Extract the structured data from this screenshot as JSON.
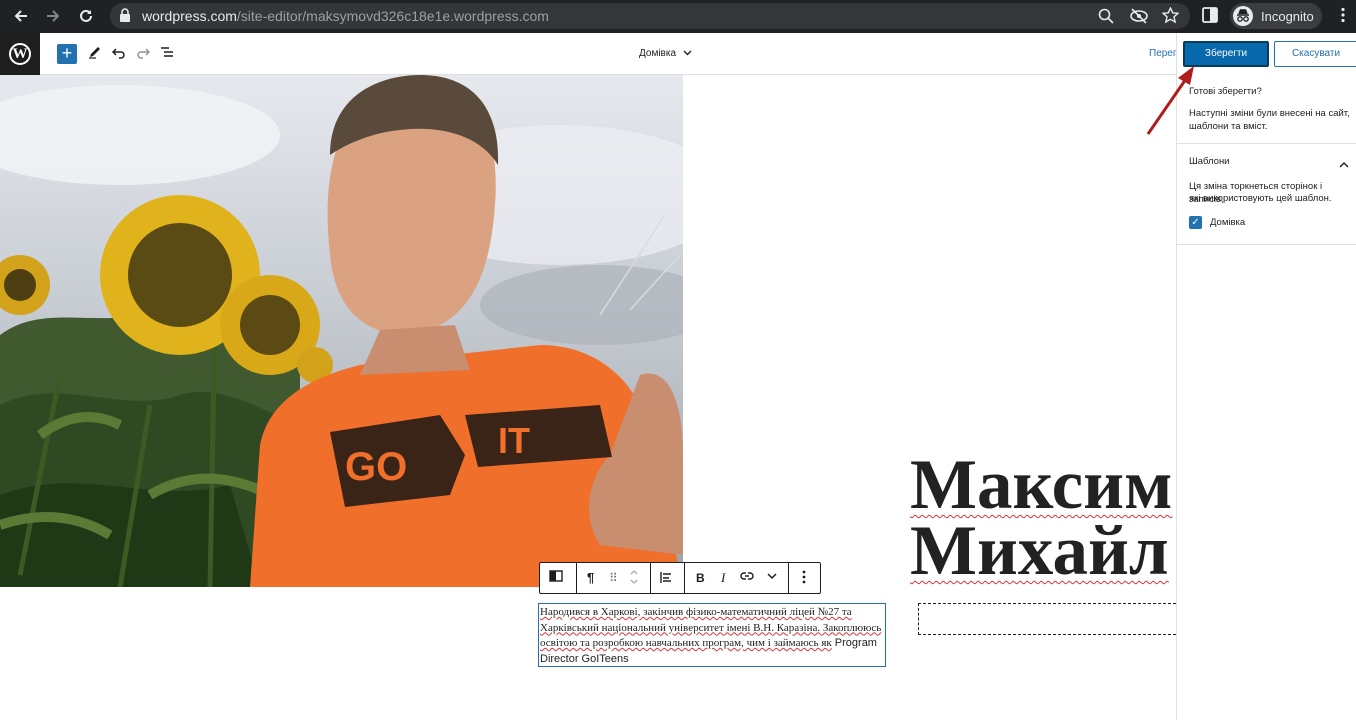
{
  "browser": {
    "url_domain": "wordpress.com",
    "url_path": "/site-editor/maksymovd326c18e1e.wordpress.com",
    "profile_label": "Incognito"
  },
  "editor": {
    "document_title": "Домівка",
    "preview_label": "Перегл"
  },
  "save_panel": {
    "save_label": "Зберегти",
    "cancel_label": "Скасувати",
    "question": "Готові зберегти?",
    "changes_line1": "Наступні зміни були внесені на сайт,",
    "changes_line2": "шаблони та вміст.",
    "templates_title": "Шаблони",
    "templates_desc_line1": "Ця зміна торкнеться сторінок і записів,",
    "templates_desc_line2": "які використовують цей шаблон.",
    "template_item": "Домівка"
  },
  "content": {
    "heading_line1": "Максим",
    "heading_line2": "Михайл",
    "para_line1": "Народився в Харкові, закінчив фізико-математичний ліцей №27 та",
    "para_line2": "Харківський національний університет імені В.Н. Каразіна. Закоплююсь",
    "para_line3": "освітою та розробкою навчальних програм, чим і займаюсь як",
    "para_line3_tail": " Program",
    "para_line4": "Director GoITeens",
    "shirt_word1": "GO",
    "shirt_word2": "IT"
  },
  "colors": {
    "accent": "#2271b1",
    "save_button": "#0868ac",
    "arrow": "#b01c1c"
  }
}
